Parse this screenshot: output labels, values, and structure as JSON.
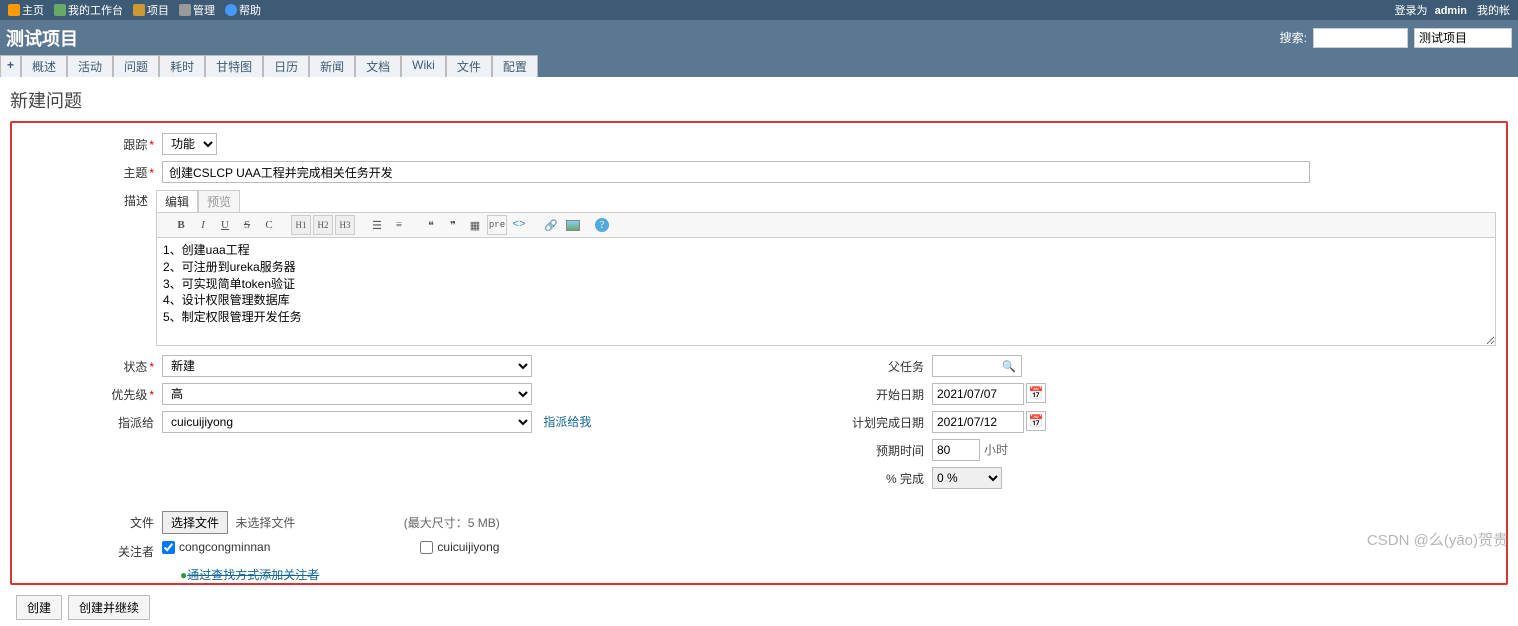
{
  "top": {
    "home": "主页",
    "mypage": "我的工作台",
    "projects": "项目",
    "admin": "管理",
    "help": "帮助",
    "logged_as_prefix": "登录为 ",
    "logged_as_user": "admin",
    "my_account": "我的帐"
  },
  "header": {
    "title": "测试项目",
    "search_label": "搜索:",
    "search_value": "",
    "project_select": "测试项目"
  },
  "tabs": {
    "plus": "+",
    "items": [
      "概述",
      "活动",
      "问题",
      "耗时",
      "甘特图",
      "日历",
      "新闻",
      "文档",
      "Wiki",
      "文件",
      "配置"
    ]
  },
  "page_title": "新建问题",
  "form": {
    "tracker_label": "跟踪",
    "tracker_value": "功能",
    "subject_label": "主题",
    "subject_value": "创建CSLCP UAA工程并完成相关任务开发",
    "desc_label": "描述",
    "edit_tab": "编辑",
    "preview_tab": "预览",
    "desc_value": "1、创建uaa工程\n2、可注册到ureka服务器\n3、可实现简单token验证\n4、设计权限管理数据库\n5、制定权限管理开发任务",
    "status_label": "状态",
    "status_value": "新建",
    "priority_label": "优先级",
    "priority_value": "高",
    "assignee_label": "指派给",
    "assignee_value": "cuicuijiyong",
    "assign_me": "指派给我",
    "parent_label": "父任务",
    "parent_value": "",
    "start_label": "开始日期",
    "start_value": "2021/07/07",
    "due_label": "计划完成日期",
    "due_value": "2021/07/12",
    "est_label": "预期时间",
    "est_value": "80",
    "est_unit": "小时",
    "done_label": "% 完成",
    "done_value": "0 %",
    "files_label": "文件",
    "choose_file": "选择文件",
    "no_file": "未选择文件",
    "max_size": "(最大尺寸：5 MB)",
    "watchers_label": "关注者",
    "watcher1": "congcongminnan",
    "watcher2": "cuicuijiyong",
    "search_add": "通过查找方式添加关注者"
  },
  "toolbar": {
    "b": "B",
    "i": "I",
    "u": "U",
    "s": "S",
    "c": "C",
    "h1": "H1",
    "h2": "H2",
    "h3": "H3",
    "pre": "pre",
    "code": "<>",
    "help": "?"
  },
  "buttons": {
    "create": "创建",
    "create_continue": "创建并继续"
  },
  "watermark": "CSDN @么(yāo)贺贵"
}
